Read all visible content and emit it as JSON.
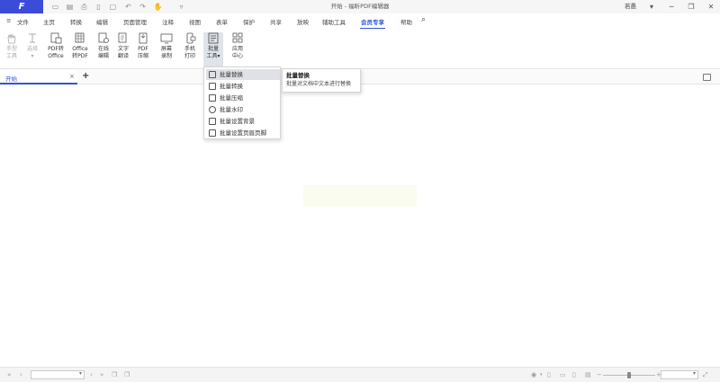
{
  "window": {
    "title": "开始 - 福昕PDF编辑器",
    "user": "若愚",
    "logo_letter": "F"
  },
  "quick_access_icons": [
    "open-icon",
    "save-icon",
    "print-icon",
    "new-icon",
    "undo-icon",
    "redo-icon",
    "hand-icon",
    "dropdown-icon"
  ],
  "menu": {
    "file": "文件",
    "tabs": [
      "主页",
      "转换",
      "编辑",
      "页面管理",
      "注释",
      "视图",
      "表单",
      "保护",
      "共享",
      "放映",
      "辅助工具",
      "会员专享",
      "帮助"
    ],
    "active": "会员专享"
  },
  "ribbon": {
    "tools": [
      {
        "line1": "手型",
        "line2": "工具",
        "disabled": true,
        "icon": "hand-icon"
      },
      {
        "line1": "选择",
        "line2": "▾",
        "disabled": true,
        "icon": "select-icon"
      },
      {
        "line1": "PDF转",
        "line2": "Office",
        "disabled": false,
        "icon": "pdf-to-office-icon"
      },
      {
        "line1": "Office",
        "line2": "转PDF",
        "disabled": false,
        "icon": "office-to-pdf-icon"
      },
      {
        "line1": "在线",
        "line2": "编辑",
        "disabled": false,
        "icon": "online-edit-icon"
      },
      {
        "line1": "文字",
        "line2": "翻译",
        "disabled": false,
        "icon": "translate-icon"
      },
      {
        "line1": "PDF",
        "line2": "压缩",
        "disabled": false,
        "icon": "compress-icon"
      },
      {
        "line1": "屏幕",
        "line2": "录制",
        "disabled": false,
        "icon": "screen-record-icon"
      },
      {
        "line1": "手机",
        "line2": "打印",
        "disabled": false,
        "icon": "phone-print-icon"
      },
      {
        "line1": "批量",
        "line2": "工具▾",
        "disabled": false,
        "icon": "batch-tools-icon"
      },
      {
        "line1": "应用",
        "line2": "中心",
        "disabled": false,
        "icon": "app-center-icon"
      }
    ]
  },
  "doc_tab": {
    "label": "开始",
    "close": "×",
    "add": "+"
  },
  "batch_menu": {
    "items": [
      "批量替换",
      "批量转换",
      "批量压缩",
      "批量水印",
      "批量设置背景",
      "批量设置页眉页脚"
    ],
    "hovered": "批量替换"
  },
  "tooltip": {
    "title": "批量替换",
    "description": "批量对文档中文本进行替换"
  },
  "status": {
    "first": "«",
    "prev": "‹",
    "next": "›",
    "last": "»",
    "page_dropdown": "▾",
    "zoom_minus": "−",
    "zoom_plus": "+",
    "zoom_dropdown": "▾"
  }
}
